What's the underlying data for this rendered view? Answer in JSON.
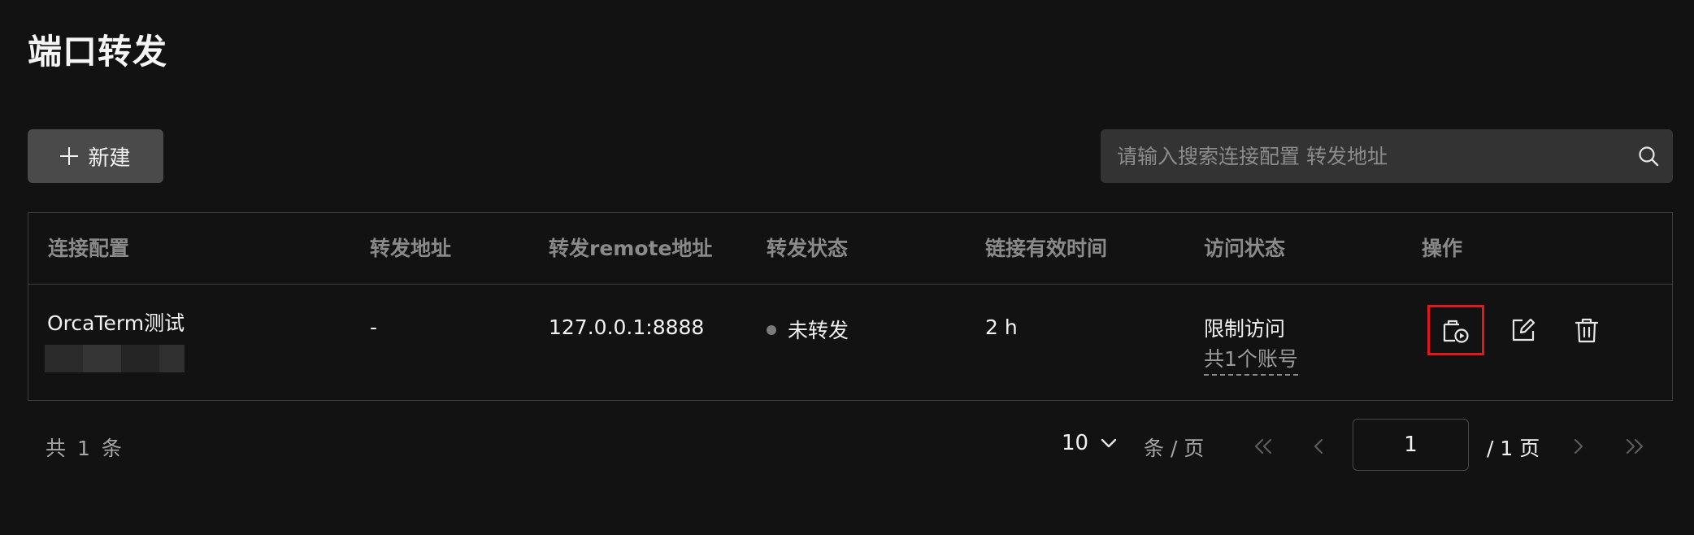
{
  "page": {
    "title": "端口转发"
  },
  "toolbar": {
    "new_label": "新建",
    "search_placeholder": "请输入搜索连接配置 转发地址"
  },
  "table": {
    "columns": [
      "连接配置",
      "转发地址",
      "转发remote地址",
      "转发状态",
      "链接有效时间",
      "访问状态",
      "操作"
    ],
    "rows": [
      {
        "connection": "OrcaTerm测试",
        "forward_address": "-",
        "remote_address": "127.0.0.1:8888",
        "status": "未转发",
        "valid_time": "2 h",
        "access": "限制访问",
        "access_detail": "共1个账号"
      }
    ]
  },
  "pagination": {
    "total_prefix": "共",
    "total_count": "1",
    "total_suffix": "条",
    "page_size": "10",
    "page_size_unit": "条 / 页",
    "current_page": "1",
    "total_pages": "/ 1 页"
  },
  "icons": {
    "search": "search-icon",
    "plus": "plus-icon",
    "start_forward": "start-forward-icon",
    "edit": "edit-icon",
    "delete": "delete-icon",
    "chevron_down": "chevron-down-icon",
    "first_page": "double-chevron-left-icon",
    "prev_page": "chevron-left-icon",
    "next_page": "chevron-right-icon",
    "last_page": "double-chevron-right-icon"
  },
  "colors": {
    "background": "#121212",
    "button": "#4a4a4a",
    "search_bg": "#333333",
    "border": "#3d3d3d",
    "highlight": "#e0191f",
    "status_dot": "#7a7a7a"
  }
}
